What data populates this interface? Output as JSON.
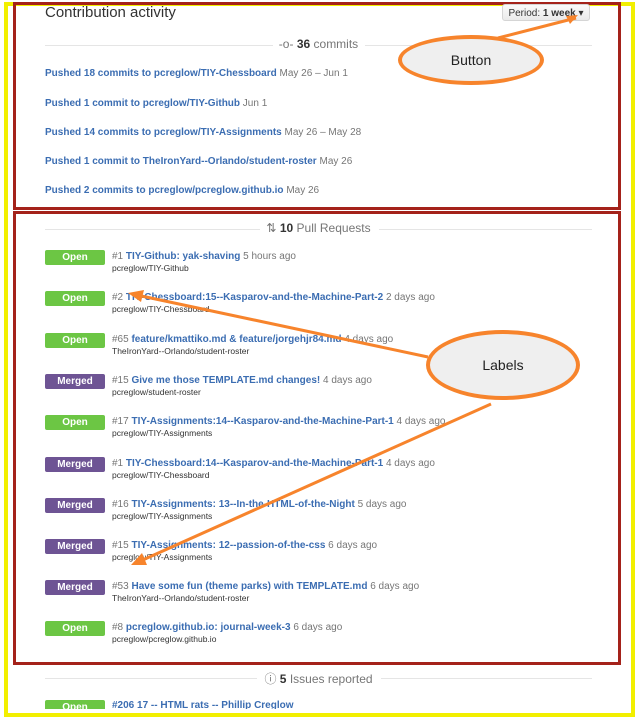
{
  "header": {
    "title": "Contribution activity",
    "period_prefix": "Period:",
    "period_value": "1 week"
  },
  "commits_section": {
    "count": "36",
    "label": "commits"
  },
  "commits": [
    {
      "text": "Pushed 18 commits to pcreglow/TIY-Chessboard",
      "date": "May 26 – Jun 1"
    },
    {
      "text": "Pushed 1 commit to pcreglow/TIY-Github",
      "date": "Jun 1"
    },
    {
      "text": "Pushed 14 commits to pcreglow/TIY-Assignments",
      "date": "May 26 – May 28"
    },
    {
      "text": "Pushed 1 commit to TheIronYard--Orlando/student-roster",
      "date": "May 26"
    },
    {
      "text": "Pushed 2 commits to pcreglow/pcreglow.github.io",
      "date": "May 26"
    }
  ],
  "prs_section": {
    "count": "10",
    "label": "Pull Requests"
  },
  "pull_requests": [
    {
      "state": "Open",
      "num": "#1",
      "title": "TIY-Github: yak-shaving",
      "ago": "5 hours ago",
      "repo": "pcreglow/TIY-Github"
    },
    {
      "state": "Open",
      "num": "#2",
      "title": "TIY-Chessboard:15--Kasparov-and-the-Machine-Part-2",
      "ago": "2 days ago",
      "repo": "pcreglow/TIY-Chessboard"
    },
    {
      "state": "Open",
      "num": "#65",
      "title": "feature/kmattiko.md & feature/jorgehjr84.md",
      "ago": "4 days ago",
      "repo": "TheIronYard--Orlando/student-roster"
    },
    {
      "state": "Merged",
      "num": "#15",
      "title": "Give me those TEMPLATE.md changes!",
      "ago": "4 days ago",
      "repo": "pcreglow/student-roster"
    },
    {
      "state": "Open",
      "num": "#17",
      "title": "TIY-Assignments:14--Kasparov-and-the-Machine-Part-1",
      "ago": "4 days ago",
      "repo": "pcreglow/TIY-Assignments"
    },
    {
      "state": "Merged",
      "num": "#1",
      "title": "TIY-Chessboard:14--Kasparov-and-the-Machine-Part-1",
      "ago": "4 days ago",
      "repo": "pcreglow/TIY-Chessboard"
    },
    {
      "state": "Merged",
      "num": "#16",
      "title": "TIY-Assignments: 13--In-the-HTML-of-the-Night",
      "ago": "5 days ago",
      "repo": "pcreglow/TIY-Assignments"
    },
    {
      "state": "Merged",
      "num": "#15",
      "title": "TIY-Assignments: 12--passion-of-the-css",
      "ago": "6 days ago",
      "repo": "pcreglow/TIY-Assignments"
    },
    {
      "state": "Merged",
      "num": "#53",
      "title": "Have some fun (theme parks) with TEMPLATE.md",
      "ago": "6 days ago",
      "repo": "TheIronYard--Orlando/student-roster"
    },
    {
      "state": "Open",
      "num": "#8",
      "title": "pcreglow.github.io: journal-week-3",
      "ago": "6 days ago",
      "repo": "pcreglow/pcreglow.github.io"
    }
  ],
  "issues_section": {
    "count": "5",
    "label": "Issues reported"
  },
  "issues_partial": {
    "state": "Open",
    "text": "#206 17 -- HTML rats -- Phillip Creglow"
  },
  "annotations": {
    "button_label": "Button",
    "labels_label": "Labels"
  },
  "colors": {
    "open": "#6cc644",
    "merged": "#6e5494",
    "link": "#3b6db2",
    "annotation_orange": "#f7842c",
    "frame_red": "#a4221a",
    "frame_yellow": "#f2ef00"
  }
}
